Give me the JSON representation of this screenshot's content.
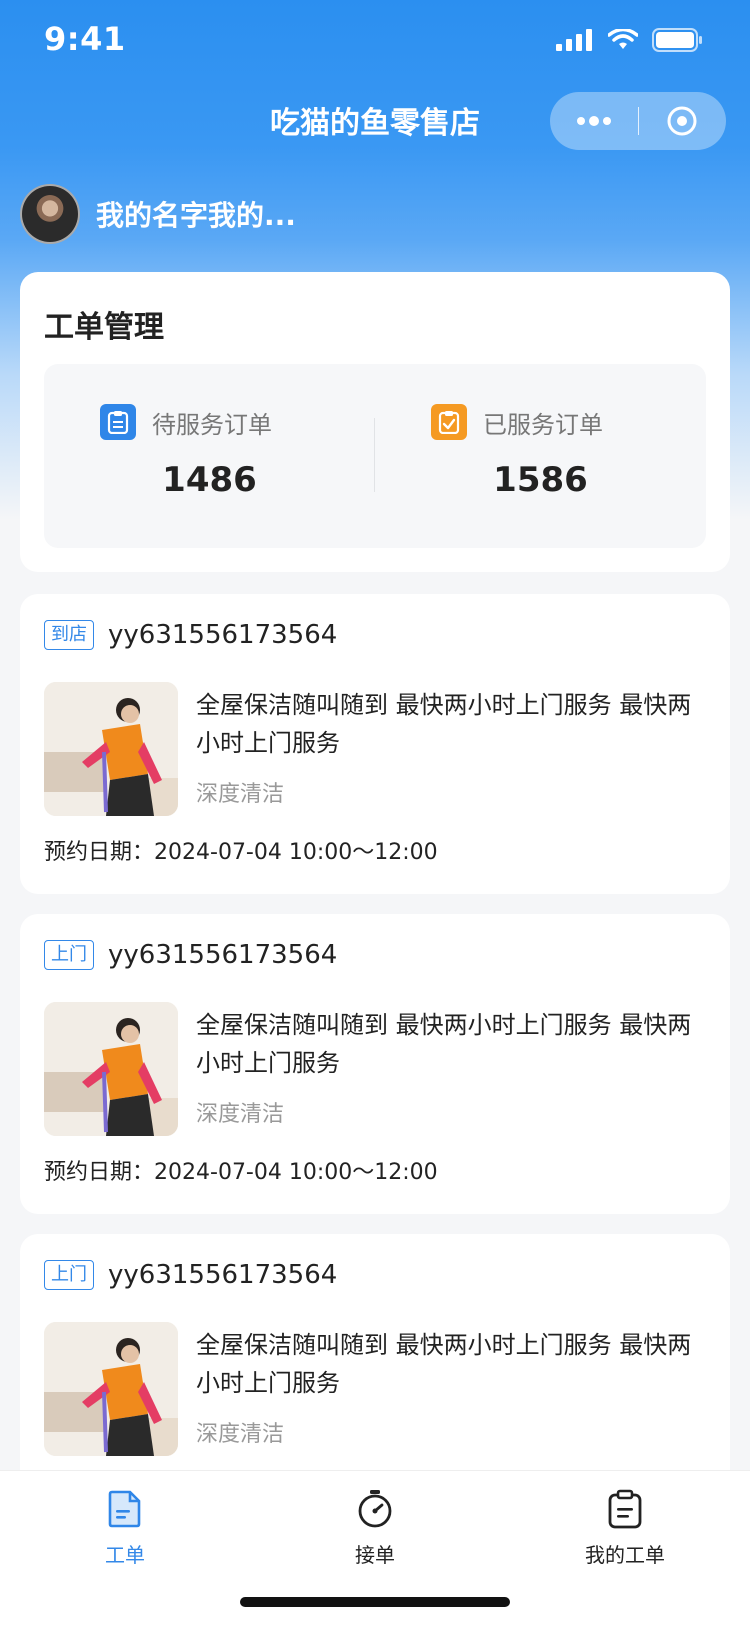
{
  "status_bar": {
    "time": "9:41"
  },
  "nav": {
    "title": "吃猫的鱼零售店"
  },
  "user": {
    "name": "我的名字我的..."
  },
  "summary": {
    "title": "工单管理",
    "pending": {
      "label": "待服务订单",
      "count": "1486",
      "icon": "clipboard-icon",
      "color": "#2f86e8"
    },
    "served": {
      "label": "已服务订单",
      "count": "1586",
      "icon": "clipboard-check-icon",
      "color": "#f59a23"
    }
  },
  "orders": [
    {
      "tag": "到店",
      "order_no": "yy631556173564",
      "title": "全屋保洁随叫随到 最快两小时上门服务 最快两小时上门服务",
      "category": "深度清洁",
      "date_label": "预约日期：",
      "date_value": "2024-07-04 10:00～12:00"
    },
    {
      "tag": "上门",
      "order_no": "yy631556173564",
      "title": "全屋保洁随叫随到 最快两小时上门服务 最快两小时上门服务",
      "category": "深度清洁",
      "date_label": "预约日期：",
      "date_value": "2024-07-04 10:00～12:00"
    },
    {
      "tag": "上门",
      "order_no": "yy631556173564",
      "title": "全屋保洁随叫随到 最快两小时上门服务 最快两小时上门服务",
      "category": "深度清洁"
    }
  ],
  "tabbar": {
    "items": [
      {
        "label": "工单",
        "icon": "document-icon",
        "active": true
      },
      {
        "label": "接单",
        "icon": "stopwatch-icon",
        "active": false
      },
      {
        "label": "我的工单",
        "icon": "clipboard-icon",
        "active": false
      }
    ]
  },
  "colors": {
    "primary": "#2f86e8",
    "accent": "#f59a23"
  }
}
